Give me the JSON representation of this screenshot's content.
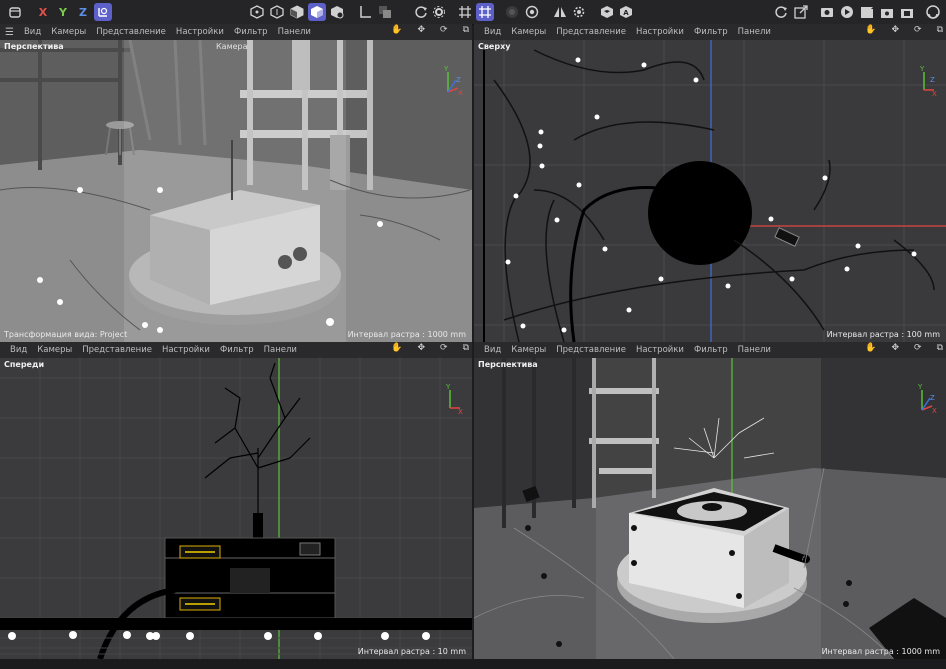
{
  "toolbar": {
    "icons": [
      "undo-icon",
      "x-axis",
      "y-axis",
      "z-axis",
      "world-coords-icon",
      "model-mode-icon",
      "points-mode-icon",
      "edges-mode-icon",
      "polygons-mode-icon",
      "object-mode-icon",
      "axis-mode-icon",
      "solo-icon",
      "rotate-icon",
      "settings-icon",
      "snap-grid-icon",
      "snap-enable-icon",
      "record-icon",
      "target-icon",
      "symmetry-icon",
      "gear-icon",
      "cube-icon",
      "a-icon",
      "reset-icon",
      "export-icon",
      "render-region-icon",
      "render-view-icon",
      "render-queue-icon",
      "render-settings-icon",
      "render-picture-icon",
      "render-active-icon",
      "app-icon"
    ],
    "x_label": "X",
    "y_label": "Y",
    "z_label": "Z"
  },
  "menus": [
    "Вид",
    "Камеры",
    "Представление",
    "Настройки",
    "Фильтр",
    "Панели"
  ],
  "viewports": {
    "tl": {
      "title": "Перспектива",
      "camera": "Камера",
      "status": "Интервал растра : 1000 mm",
      "status_left": "Трансформация вида: Project"
    },
    "tr": {
      "title": "Сверху",
      "status": "Интервал растра : 100 mm"
    },
    "bl": {
      "title": "Спереди",
      "status": "Интервал растра : 10 mm"
    },
    "br": {
      "title": "Перспектива",
      "status": "Интервал растра : 1000 mm"
    }
  },
  "axis": {
    "x": "X",
    "y": "Y",
    "z": "Z"
  },
  "colors": {
    "x_axis": "#e0463e",
    "y_axis": "#58c23a",
    "z_axis": "#3f6fe0",
    "accent": "#5d60c8"
  }
}
